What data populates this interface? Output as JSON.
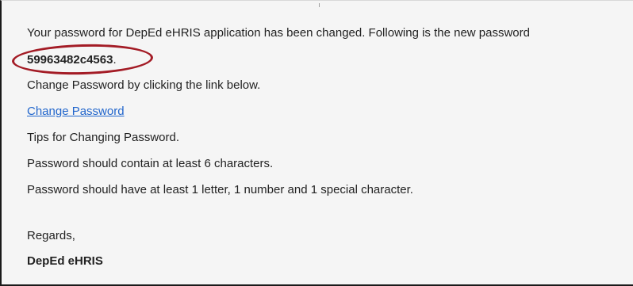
{
  "email": {
    "intro": "Your password for DepEd eHRIS application has been changed. Following is the new password",
    "new_password": "59963482c4563",
    "password_suffix": ".",
    "change_instruction": "Change Password by clicking the link below.",
    "change_link_label": "Change Password",
    "tips_heading": "Tips for Changing Password.",
    "tip_length": "Password should contain at least 6 characters.",
    "tip_composition": "Password should have at least 1 letter, 1 number and 1 special character.",
    "closing": "Regards,",
    "signature": "DepEd eHRIS"
  },
  "colors": {
    "link": "#2266cc",
    "highlight_ring": "#a31b25",
    "background": "#f5f5f5"
  }
}
